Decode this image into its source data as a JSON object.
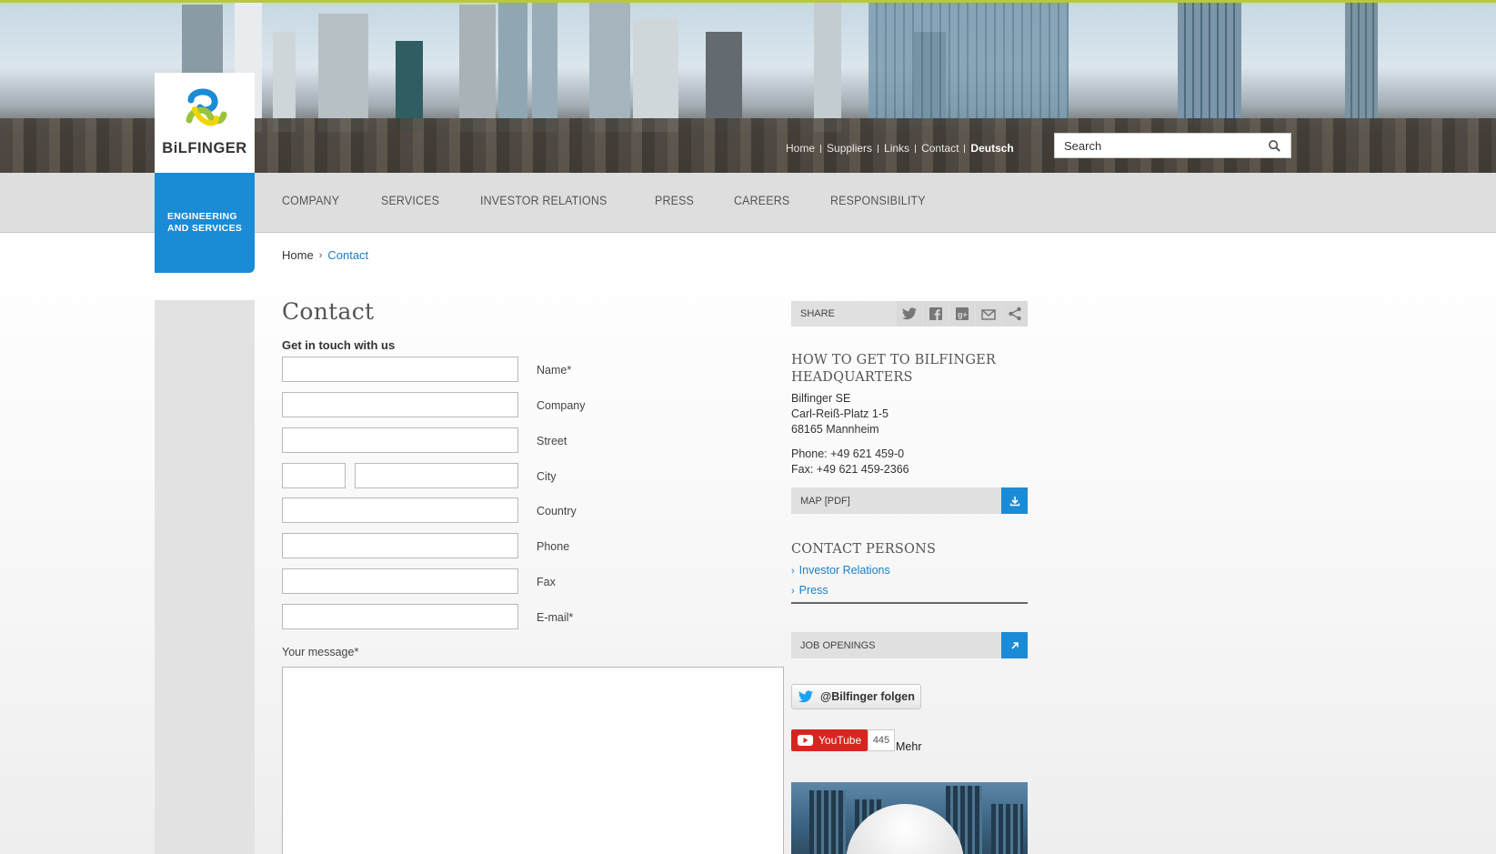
{
  "brand": {
    "name": "BiLFINGER",
    "tagline_line1": "ENGINEERING",
    "tagline_line2": "AND SERVICES"
  },
  "topnav": {
    "items": [
      {
        "label": "Home"
      },
      {
        "label": "Suppliers"
      },
      {
        "label": "Links"
      },
      {
        "label": "Contact"
      },
      {
        "label": "Deutsch"
      }
    ]
  },
  "search": {
    "placeholder": "Search"
  },
  "mainnav": {
    "items": [
      {
        "label": "COMPANY"
      },
      {
        "label": "SERVICES"
      },
      {
        "label": "INVESTOR RELATIONS"
      },
      {
        "label": "PRESS"
      },
      {
        "label": "CAREERS"
      },
      {
        "label": "RESPONSIBILITY"
      }
    ]
  },
  "breadcrumb": {
    "home": "Home",
    "separator": "›",
    "current": "Contact"
  },
  "page": {
    "title": "Contact",
    "subtitle": "Get in touch with us"
  },
  "form": {
    "fields": [
      {
        "label": "Name*"
      },
      {
        "label": "Company"
      },
      {
        "label": "Street"
      },
      {
        "label": "City"
      },
      {
        "label": "Country"
      },
      {
        "label": "Phone"
      },
      {
        "label": "Fax"
      },
      {
        "label": "E-mail*"
      }
    ],
    "message_label": "Your message*"
  },
  "share": {
    "label": "SHARE",
    "icons": [
      "twitter-icon",
      "facebook-icon",
      "google-plus-icon",
      "email-icon",
      "share-icon"
    ]
  },
  "headquarters": {
    "title_line1": "HOW TO GET TO BILFINGER",
    "title_line2": "HEADQUARTERS",
    "company": "Bilfinger SE",
    "street": "Carl-Reiß-Platz 1-5",
    "city": "68165 Mannheim",
    "phone": "Phone: +49 621 459-0",
    "fax": "Fax: +49 621 459-2366",
    "map_label": "MAP [PDF]"
  },
  "contact_persons": {
    "title": "CONTACT PERSONS",
    "links": [
      {
        "label": "Investor Relations"
      },
      {
        "label": "Press"
      }
    ]
  },
  "jobs": {
    "label": "JOB OPENINGS"
  },
  "social": {
    "twitter_label": "@Bilfinger folgen",
    "youtube_label": "YouTube",
    "youtube_count": "445",
    "more_label": "Mehr"
  },
  "colors": {
    "accent_blue": "#1a8bd6",
    "link_blue": "#1a7fc6",
    "top_line": "#b9c83a",
    "youtube_red": "#d9251f"
  }
}
